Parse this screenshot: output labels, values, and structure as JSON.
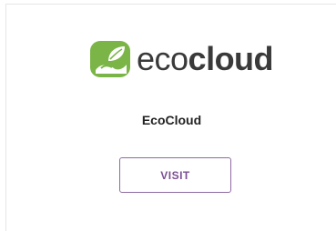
{
  "card": {
    "logo": {
      "icon": "ecocloud-leaf-icon",
      "text_prefix": "eco",
      "text_suffix": "cloud",
      "brand_green": "#7bb548"
    },
    "title": "EcoCloud",
    "visit_label": "VISIT",
    "accent": "#7a4f93"
  }
}
